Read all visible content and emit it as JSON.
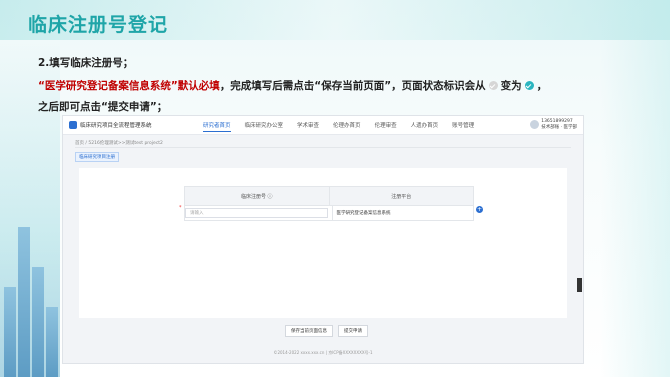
{
  "slide": {
    "title": "临床注册号登记",
    "step": "2.填写临床注册号；",
    "instr_red": "“医学研究登记备案信息系统”默认必填",
    "instr_mid": "，完成填写后需点击“保存当前页面”，页面状态标识会从",
    "instr_change": "变为",
    "instr_end": "，",
    "instr_line3": "之后即可点击“提交申请”；"
  },
  "screenshot": {
    "system_name": "临床研究项目全流程管理系统",
    "nav": [
      "研究者首页",
      "临床研究办公室",
      "学术审查",
      "伦理办首页",
      "伦理审查",
      "人遗办首页",
      "账号管理"
    ],
    "user_line1": "13651899297",
    "user_line2": "技术部账 · 医学部",
    "breadcrumb": "首页 / 5216伦理测试>>测试test project2",
    "tag": "临床研究项目注册",
    "table": {
      "headers": [
        "临床注册号 ⓘ",
        "注册平台"
      ],
      "row": {
        "placeholder": "请输入",
        "platform": "医学研究登记备案信息系统"
      }
    },
    "buttons": {
      "save": "保存当前页面信息",
      "submit": "提交申请"
    },
    "footer": "©2014-2022 xxxx.xxx.cn | 京ICP备XXXXXXXX号-1"
  },
  "colors": {
    "title": "#1fa5a8",
    "red": "#c00000",
    "accent": "#2c6fd1",
    "status_done": "#2bb5c0"
  }
}
